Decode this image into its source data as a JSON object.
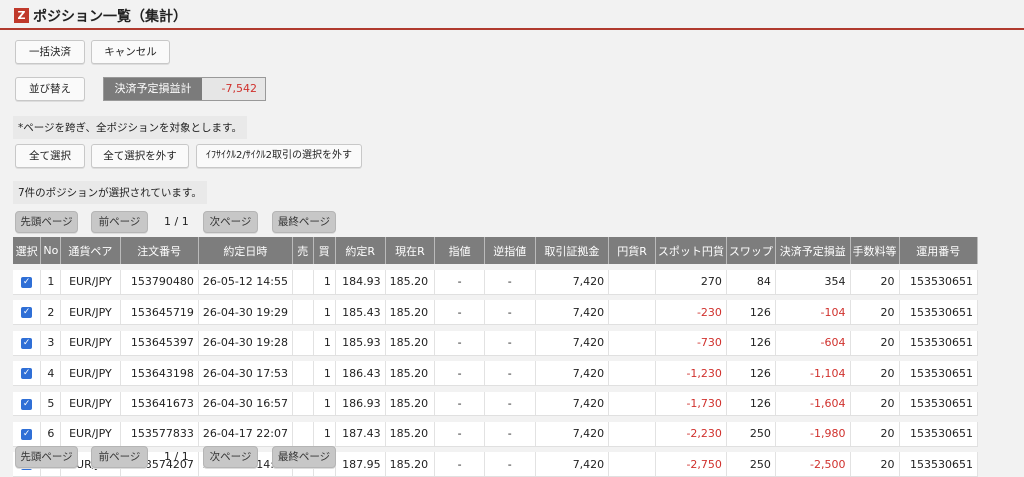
{
  "header": {
    "logo": "Z",
    "title": "ポジション一覧（集計）"
  },
  "buttons": {
    "bulk_settle": "一括決済",
    "cancel": "キャンセル",
    "sort": "並び替え",
    "select_all": "全て選択",
    "deselect_all": "全て選択を外す",
    "deselect_cycle": "ｲﾌｻｲｸﾙ2/ｻｲｸﾙ2取引の選択を外す"
  },
  "planned_pl": {
    "label": "決済予定損益計",
    "value": "-7,542"
  },
  "notes": {
    "scope": "*ページを跨ぎ、全ポジションを対象とします。",
    "selected": "7件のポジションが選択されています。"
  },
  "pager": {
    "first": "先頭ページ",
    "prev": "前ページ",
    "info": "1 / 1",
    "next": "次ページ",
    "last": "最終ページ"
  },
  "table": {
    "headers": [
      "選択",
      "No",
      "通貨ペア",
      "注文番号",
      "約定日時",
      "売",
      "買",
      "約定R",
      "現在R",
      "指値",
      "逆指値",
      "取引証拠金",
      "円貨R",
      "スポット円貨",
      "スワップ",
      "決済予定損益",
      "手数料等",
      "運用番号"
    ],
    "rows": [
      {
        "no": "1",
        "pair": "EUR/JPY",
        "order": "153790480",
        "datetime": "26-05-12 14:55",
        "sell": "",
        "buy": "1",
        "rate": "184.93",
        "current": "185.20",
        "limit": "-",
        "stop": "-",
        "margin": "7,420",
        "yen": "",
        "spot": "270",
        "swap": "84",
        "pl": "354",
        "fee": "20",
        "op": "153530651"
      },
      {
        "no": "2",
        "pair": "EUR/JPY",
        "order": "153645719",
        "datetime": "26-04-30 19:29",
        "sell": "",
        "buy": "1",
        "rate": "185.43",
        "current": "185.20",
        "limit": "-",
        "stop": "-",
        "margin": "7,420",
        "yen": "",
        "spot": "-230",
        "swap": "126",
        "pl": "-104",
        "fee": "20",
        "op": "153530651"
      },
      {
        "no": "3",
        "pair": "EUR/JPY",
        "order": "153645397",
        "datetime": "26-04-30 19:28",
        "sell": "",
        "buy": "1",
        "rate": "185.93",
        "current": "185.20",
        "limit": "-",
        "stop": "-",
        "margin": "7,420",
        "yen": "",
        "spot": "-730",
        "swap": "126",
        "pl": "-604",
        "fee": "20",
        "op": "153530651"
      },
      {
        "no": "4",
        "pair": "EUR/JPY",
        "order": "153643198",
        "datetime": "26-04-30 17:53",
        "sell": "",
        "buy": "1",
        "rate": "186.43",
        "current": "185.20",
        "limit": "-",
        "stop": "-",
        "margin": "7,420",
        "yen": "",
        "spot": "-1,230",
        "swap": "126",
        "pl": "-1,104",
        "fee": "20",
        "op": "153530651"
      },
      {
        "no": "5",
        "pair": "EUR/JPY",
        "order": "153641673",
        "datetime": "26-04-30 16:57",
        "sell": "",
        "buy": "1",
        "rate": "186.93",
        "current": "185.20",
        "limit": "-",
        "stop": "-",
        "margin": "7,420",
        "yen": "",
        "spot": "-1,730",
        "swap": "126",
        "pl": "-1,604",
        "fee": "20",
        "op": "153530651"
      },
      {
        "no": "6",
        "pair": "EUR/JPY",
        "order": "153577833",
        "datetime": "26-04-17 22:07",
        "sell": "",
        "buy": "1",
        "rate": "187.43",
        "current": "185.20",
        "limit": "-",
        "stop": "-",
        "margin": "7,420",
        "yen": "",
        "spot": "-2,230",
        "swap": "250",
        "pl": "-1,980",
        "fee": "20",
        "op": "153530651"
      },
      {
        "no": "7",
        "pair": "EUR/JPY",
        "order": "153574207",
        "datetime": "26-04-17 14:14",
        "sell": "",
        "buy": "1",
        "rate": "187.95",
        "current": "185.20",
        "limit": "-",
        "stop": "-",
        "margin": "7,420",
        "yen": "",
        "spot": "-2,750",
        "swap": "250",
        "pl": "-2,500",
        "fee": "20",
        "op": "153530651"
      }
    ]
  },
  "colors": {
    "accent": "#b03a2e",
    "negative": "#d0312d",
    "header_bg": "#7d7d7d",
    "checkbox": "#2f6fd6"
  },
  "icons": {
    "checkbox": "checkbox-checked-icon"
  }
}
